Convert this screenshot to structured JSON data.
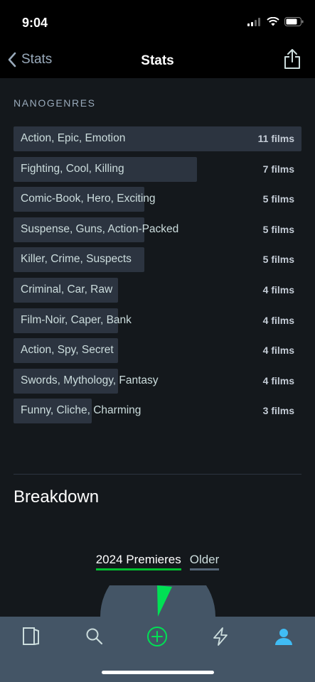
{
  "status_bar": {
    "time": "9:04"
  },
  "nav": {
    "back_label": "Stats",
    "title": "Stats"
  },
  "section": {
    "label": "NANOGENRES"
  },
  "nanogenres": [
    {
      "name": "Action, Epic, Emotion",
      "count": "11 films",
      "films": 11
    },
    {
      "name": "Fighting, Cool, Killing",
      "count": "7 films",
      "films": 7
    },
    {
      "name": "Comic-Book, Hero, Exciting",
      "count": "5 films",
      "films": 5
    },
    {
      "name": "Suspense, Guns, Action-Packed",
      "count": "5 films",
      "films": 5
    },
    {
      "name": "Killer, Crime, Suspects",
      "count": "5 films",
      "films": 5
    },
    {
      "name": "Criminal, Car, Raw",
      "count": "4 films",
      "films": 4
    },
    {
      "name": "Film-Noir, Caper, Bank",
      "count": "4 films",
      "films": 4
    },
    {
      "name": "Action, Spy, Secret",
      "count": "4 films",
      "films": 4
    },
    {
      "name": "Swords, Mythology, Fantasy",
      "count": "4 films",
      "films": 4
    },
    {
      "name": "Funny, Cliche, Charming",
      "count": "3 films",
      "films": 3
    }
  ],
  "breakdown": {
    "title": "Breakdown",
    "tabs": [
      {
        "label": "2024 Premieres",
        "active": true
      },
      {
        "label": "Older",
        "active": false
      }
    ]
  },
  "colors": {
    "accent": "#00e054",
    "bar": "#2c3440",
    "tab_bar": "#445566",
    "active_icon": "#40bcf4"
  },
  "tab_bar": {
    "items": [
      "diary-icon",
      "search-icon",
      "add-icon",
      "activity-icon",
      "profile-icon"
    ]
  }
}
